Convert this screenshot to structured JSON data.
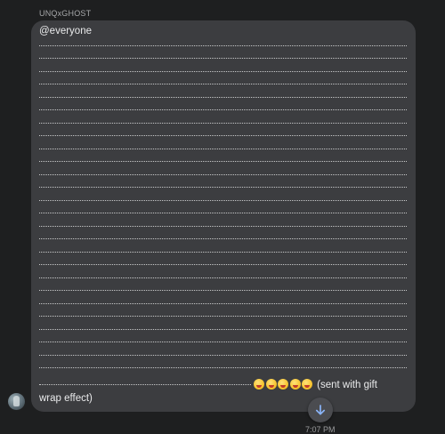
{
  "message": {
    "sender": "UNQxGHOST",
    "first_line": "@everyone",
    "emojis": [
      "😝",
      "😝",
      "😝",
      "😝",
      "😝"
    ],
    "trailing_text": "(sent with gift wrap effect)",
    "timestamp": "7:07 PM"
  },
  "controls": {
    "scroll_down_icon": "arrow-down-icon"
  },
  "colors": {
    "background": "#1e1f20",
    "bubble": "#3c3d40",
    "text": "#e9eaeb",
    "accent": "#8ab4f8"
  }
}
